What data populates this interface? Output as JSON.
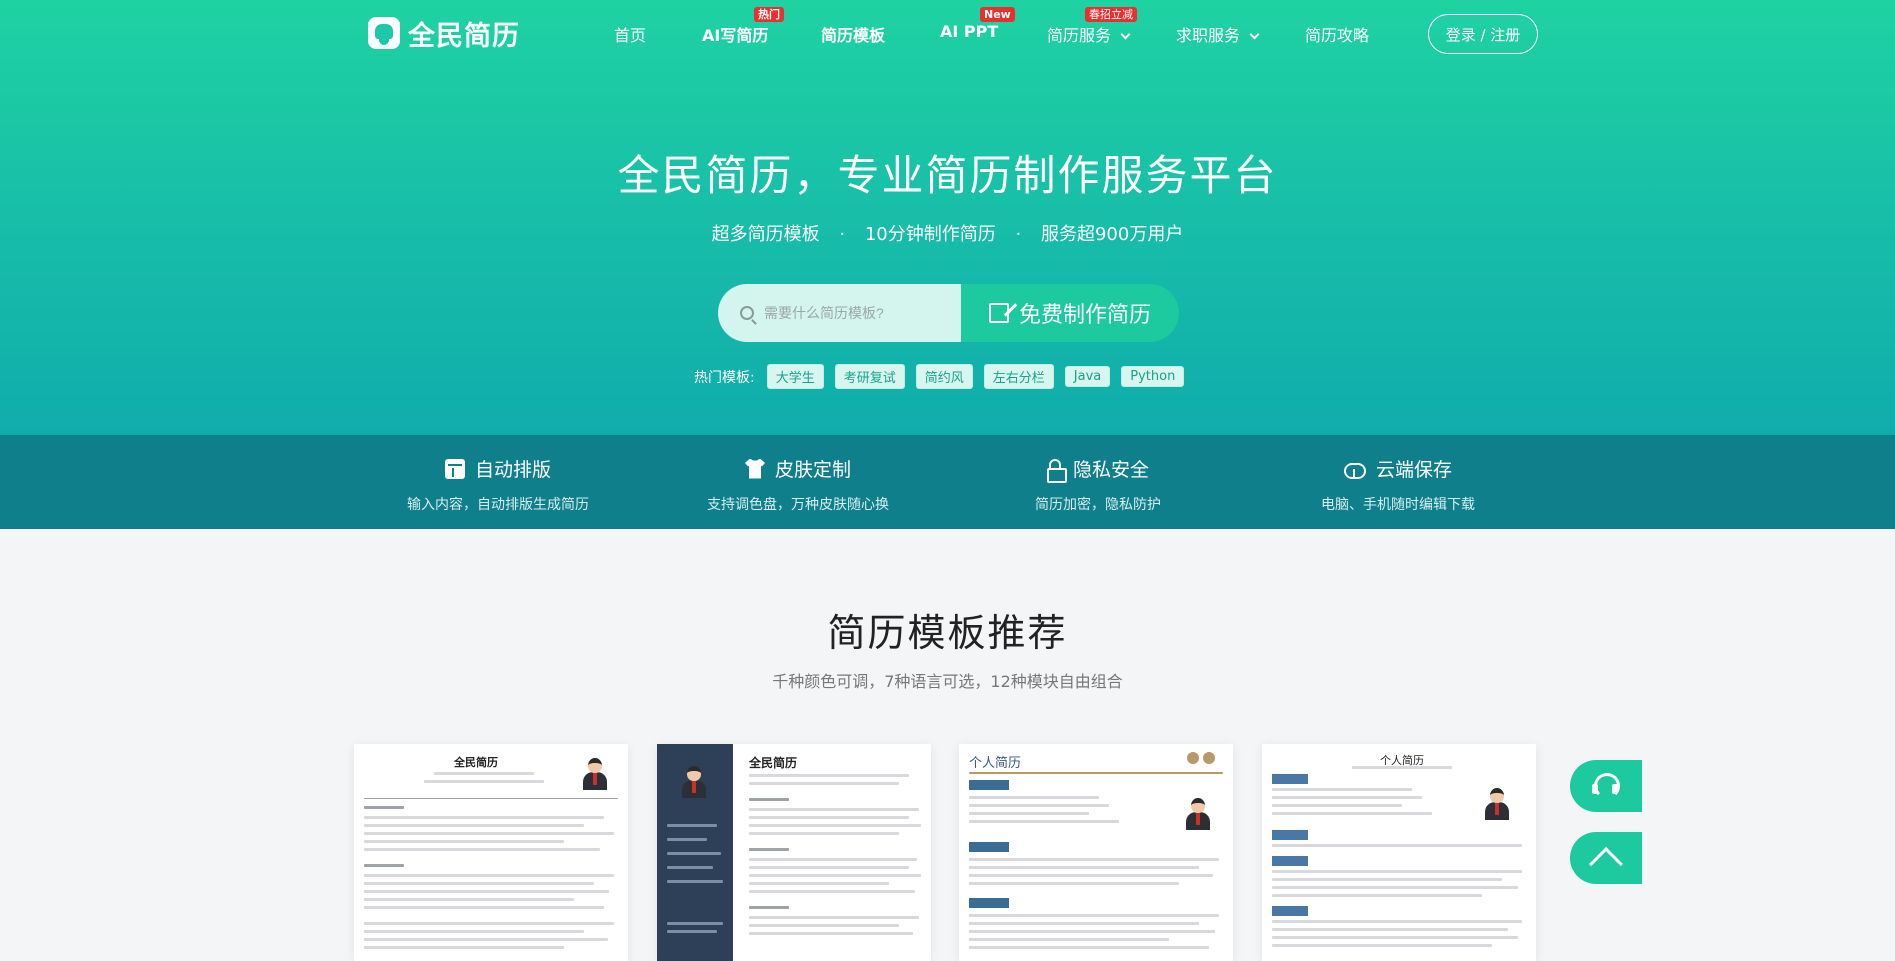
{
  "brand": {
    "name": "全民简历",
    "accent": "#1dc99f"
  },
  "nav": {
    "items": [
      {
        "label": "首页",
        "badge": ""
      },
      {
        "label": "AI写简历",
        "badge": "热门"
      },
      {
        "label": "简历模板",
        "badge": ""
      },
      {
        "label": "AI PPT",
        "badge": "New"
      },
      {
        "label": "简历服务",
        "badge": "春招立减"
      },
      {
        "label": "求职服务",
        "badge": ""
      },
      {
        "label": "简历攻略",
        "badge": ""
      }
    ],
    "login_label": "登录 / 注册"
  },
  "hero": {
    "title": "全民简历，专业简历制作服务平台",
    "sub": [
      "超多简历模板",
      "10分钟制作简历",
      "服务超900万用户"
    ],
    "separator": "·",
    "search_placeholder": "需要什么简历模板?",
    "cta_label": "免费制作简历",
    "hot_label": "热门模板:",
    "hot_tags": [
      "大学生",
      "考研复试",
      "简约风",
      "左右分栏",
      "Java",
      "Python"
    ]
  },
  "features": [
    {
      "icon": "layout-icon",
      "title": "自动排版",
      "desc": "输入内容，自动排版生成简历"
    },
    {
      "icon": "shirt-icon",
      "title": "皮肤定制",
      "desc": "支持调色盘，万种皮肤随心换"
    },
    {
      "icon": "lock-icon",
      "title": "隐私安全",
      "desc": "简历加密，隐私防护"
    },
    {
      "icon": "cloud-icon",
      "title": "云端保存",
      "desc": "电脑、手机随时编辑下载"
    }
  ],
  "templates_section": {
    "title": "简历模板推荐",
    "subtitle": "千种颜色可调，7种语言可选，12种模块自由组合",
    "cards": [
      {
        "heading": "全民简历"
      },
      {
        "heading": "全民简历"
      },
      {
        "heading": "个人简历"
      },
      {
        "heading": "个人简历"
      }
    ]
  }
}
